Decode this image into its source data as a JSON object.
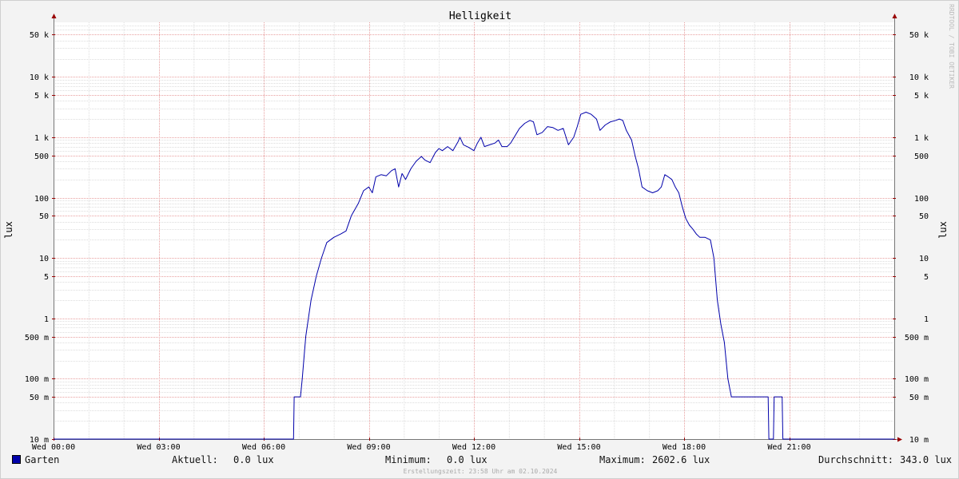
{
  "chart_data": {
    "type": "line",
    "title": "Helligkeit",
    "ylabel_left": "lux",
    "ylabel_right": "lux",
    "watermark": "RRDTOOL / TOBI OETIKER",
    "y_scale": "log",
    "ylim": [
      0.01,
      80000
    ],
    "xlim_hours": [
      0,
      24
    ],
    "grid": true,
    "x_ticks": [
      {
        "t": 0,
        "label": "Wed 00:00"
      },
      {
        "t": 3,
        "label": "Wed 03:00"
      },
      {
        "t": 6,
        "label": "Wed 06:00"
      },
      {
        "t": 9,
        "label": "Wed 09:00"
      },
      {
        "t": 12,
        "label": "Wed 12:00"
      },
      {
        "t": 15,
        "label": "Wed 15:00"
      },
      {
        "t": 18,
        "label": "Wed 18:00"
      },
      {
        "t": 21,
        "label": "Wed 21:00"
      }
    ],
    "y_ticks": [
      {
        "v": 50000,
        "label": "50 k"
      },
      {
        "v": 10000,
        "label": "10 k"
      },
      {
        "v": 5000,
        "label": "5 k"
      },
      {
        "v": 1000,
        "label": "1 k"
      },
      {
        "v": 500,
        "label": "500"
      },
      {
        "v": 100,
        "label": "100"
      },
      {
        "v": 50,
        "label": "50"
      },
      {
        "v": 10,
        "label": "10"
      },
      {
        "v": 5,
        "label": "5"
      },
      {
        "v": 1,
        "label": "1"
      },
      {
        "v": 0.5,
        "label": "500 m"
      },
      {
        "v": 0.1,
        "label": "100 m"
      },
      {
        "v": 0.05,
        "label": "50 m"
      },
      {
        "v": 0.01,
        "label": "10 m"
      }
    ],
    "series": [
      {
        "name": "Garten",
        "color": "#0000aa",
        "points": [
          [
            0,
            0.01
          ],
          [
            6.85,
            0.01
          ],
          [
            6.87,
            0.05
          ],
          [
            7.05,
            0.05
          ],
          [
            7.1,
            0.1
          ],
          [
            7.2,
            0.5
          ],
          [
            7.35,
            2
          ],
          [
            7.5,
            5
          ],
          [
            7.65,
            10
          ],
          [
            7.8,
            18
          ],
          [
            8.0,
            22
          ],
          [
            8.2,
            25
          ],
          [
            8.35,
            28
          ],
          [
            8.5,
            50
          ],
          [
            8.7,
            80
          ],
          [
            8.85,
            130
          ],
          [
            9.0,
            150
          ],
          [
            9.1,
            120
          ],
          [
            9.2,
            220
          ],
          [
            9.35,
            240
          ],
          [
            9.5,
            230
          ],
          [
            9.65,
            280
          ],
          [
            9.75,
            300
          ],
          [
            9.85,
            150
          ],
          [
            9.95,
            250
          ],
          [
            10.05,
            200
          ],
          [
            10.2,
            300
          ],
          [
            10.35,
            400
          ],
          [
            10.5,
            480
          ],
          [
            10.6,
            420
          ],
          [
            10.75,
            380
          ],
          [
            10.9,
            560
          ],
          [
            11.0,
            650
          ],
          [
            11.1,
            600
          ],
          [
            11.25,
            700
          ],
          [
            11.4,
            600
          ],
          [
            11.55,
            850
          ],
          [
            11.6,
            1000
          ],
          [
            11.7,
            750
          ],
          [
            11.85,
            680
          ],
          [
            12.0,
            600
          ],
          [
            12.1,
            800
          ],
          [
            12.2,
            1000
          ],
          [
            12.3,
            700
          ],
          [
            12.45,
            750
          ],
          [
            12.6,
            800
          ],
          [
            12.7,
            900
          ],
          [
            12.8,
            700
          ],
          [
            12.95,
            700
          ],
          [
            13.05,
            800
          ],
          [
            13.15,
            1000
          ],
          [
            13.3,
            1400
          ],
          [
            13.45,
            1700
          ],
          [
            13.6,
            1900
          ],
          [
            13.7,
            1800
          ],
          [
            13.8,
            1100
          ],
          [
            13.95,
            1200
          ],
          [
            14.1,
            1500
          ],
          [
            14.25,
            1450
          ],
          [
            14.4,
            1300
          ],
          [
            14.55,
            1400
          ],
          [
            14.7,
            750
          ],
          [
            14.85,
            1000
          ],
          [
            14.95,
            1500
          ],
          [
            15.05,
            2400
          ],
          [
            15.2,
            2600
          ],
          [
            15.35,
            2400
          ],
          [
            15.5,
            2000
          ],
          [
            15.6,
            1300
          ],
          [
            15.75,
            1600
          ],
          [
            15.9,
            1800
          ],
          [
            16.05,
            1900
          ],
          [
            16.15,
            2000
          ],
          [
            16.25,
            1900
          ],
          [
            16.35,
            1300
          ],
          [
            16.5,
            900
          ],
          [
            16.6,
            500
          ],
          [
            16.7,
            300
          ],
          [
            16.8,
            150
          ],
          [
            16.95,
            130
          ],
          [
            17.1,
            120
          ],
          [
            17.25,
            130
          ],
          [
            17.35,
            150
          ],
          [
            17.45,
            240
          ],
          [
            17.55,
            220
          ],
          [
            17.65,
            200
          ],
          [
            17.75,
            150
          ],
          [
            17.85,
            120
          ],
          [
            17.95,
            70
          ],
          [
            18.05,
            45
          ],
          [
            18.15,
            35
          ],
          [
            18.25,
            30
          ],
          [
            18.35,
            25
          ],
          [
            18.45,
            22
          ],
          [
            18.6,
            22
          ],
          [
            18.75,
            20
          ],
          [
            18.85,
            10
          ],
          [
            18.95,
            2
          ],
          [
            19.05,
            0.8
          ],
          [
            19.15,
            0.4
          ],
          [
            19.25,
            0.1
          ],
          [
            19.35,
            0.05
          ],
          [
            20.4,
            0.05
          ],
          [
            20.42,
            0.01
          ],
          [
            20.55,
            0.01
          ],
          [
            20.57,
            0.05
          ],
          [
            20.8,
            0.05
          ],
          [
            20.82,
            0.01
          ],
          [
            24,
            0.01
          ]
        ]
      }
    ]
  },
  "legend": {
    "series_name": "Garten",
    "swatch_color": "#0000aa",
    "current_label": "Aktuell:",
    "current_value": "0.0 lux",
    "min_label": "Minimum:",
    "min_value": "0.0 lux",
    "max_label": "Maximum:",
    "max_value": "2602.6 lux",
    "avg_label": "Durchschnitt:",
    "avg_value": "343.0 lux"
  },
  "footer": {
    "timestamp": "Erstellungszeit: 23:58 Uhr am 02.10.2024"
  }
}
